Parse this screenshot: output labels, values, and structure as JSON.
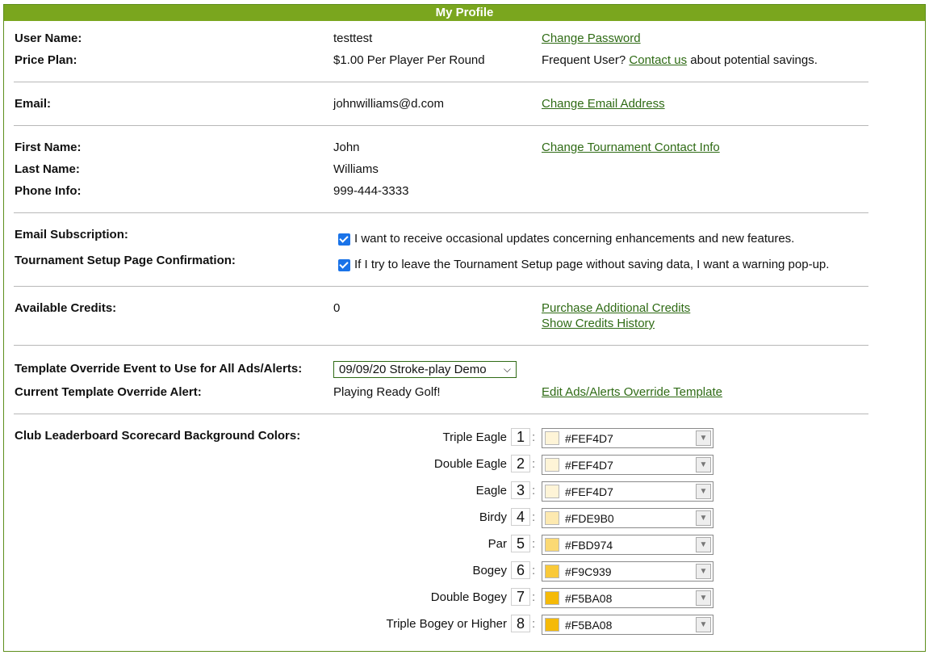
{
  "title": "My Profile",
  "account": {
    "user_name_label": "User Name:",
    "user_name": "testtest",
    "change_password": "Change Password",
    "price_plan_label": "Price Plan:",
    "price_plan": "$1.00 Per Player Per Round",
    "frequent_prefix": "Frequent User? ",
    "contact_us": "Contact us",
    "frequent_suffix": " about potential savings."
  },
  "email": {
    "label": "Email:",
    "value": "johnwilliams@d.com",
    "change_link": "Change Email Address"
  },
  "contact": {
    "first_name_label": "First Name:",
    "first_name": "John",
    "last_name_label": "Last Name:",
    "last_name": "Williams",
    "phone_label": "Phone Info:",
    "phone": "999-444-3333",
    "change_link": "Change Tournament Contact Info"
  },
  "preferences": {
    "subscription_label": "Email Subscription:",
    "subscription_text": "I want to receive occasional updates concerning enhancements and new features.",
    "subscription_checked": true,
    "confirmation_label": "Tournament Setup Page Confirmation:",
    "confirmation_text": "If I try to leave the Tournament Setup page without saving data, I want a warning pop-up.",
    "confirmation_checked": true
  },
  "credits": {
    "label": "Available Credits:",
    "value": "0",
    "purchase_link": "Purchase Additional Credits",
    "history_link": "Show Credits History"
  },
  "template": {
    "event_label": "Template Override Event to Use for All Ads/Alerts:",
    "event_selected": "09/09/20 Stroke-play Demo",
    "alert_label": "Current Template Override Alert:",
    "alert_value": "Playing Ready Golf!",
    "edit_link": "Edit Ads/Alerts Override Template"
  },
  "colors": {
    "label": "Club Leaderboard Scorecard Background Colors:",
    "items": [
      {
        "name": "Triple Eagle",
        "index": "1",
        "hex": "#FEF4D7"
      },
      {
        "name": "Double Eagle",
        "index": "2",
        "hex": "#FEF4D7"
      },
      {
        "name": "Eagle",
        "index": "3",
        "hex": "#FEF4D7"
      },
      {
        "name": "Birdy",
        "index": "4",
        "hex": "#FDE9B0"
      },
      {
        "name": "Par",
        "index": "5",
        "hex": "#FBD974"
      },
      {
        "name": "Bogey",
        "index": "6",
        "hex": "#F9C939"
      },
      {
        "name": "Double Bogey",
        "index": "7",
        "hex": "#F5BA08"
      },
      {
        "name": "Triple Bogey or Higher",
        "index": "8",
        "hex": "#F5BA08"
      }
    ]
  }
}
